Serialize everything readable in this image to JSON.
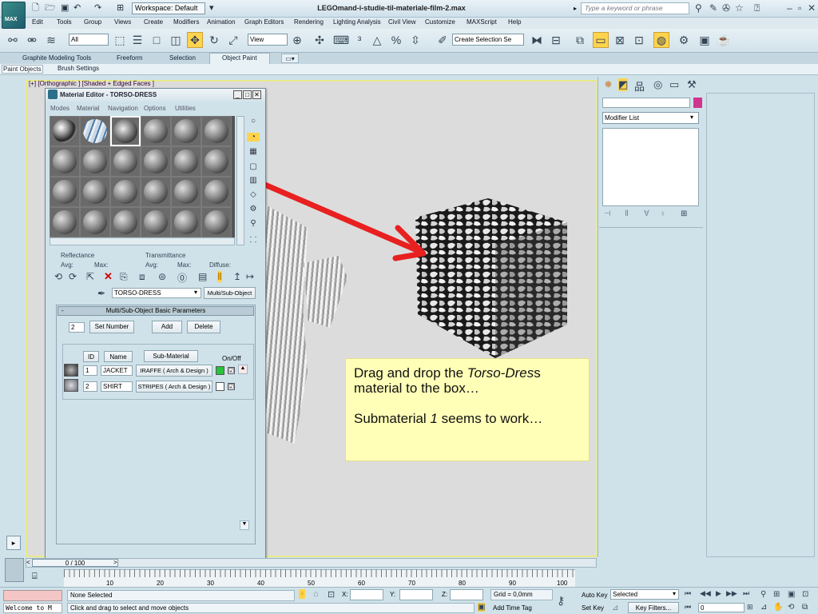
{
  "app": {
    "logo_text": "MAX",
    "workspace": "Workspace: Default",
    "window_title": "LEGOmand-i-studie-til-materiale-film-2.max",
    "search_placeholder": "Type a keyword or phrase"
  },
  "menus": [
    "Edit",
    "Tools",
    "Group",
    "Views",
    "Create",
    "Modifiers",
    "Animation",
    "Graph Editors",
    "Rendering",
    "Lighting Analysis",
    "Civil View",
    "Customize",
    "MAXScript",
    "Help"
  ],
  "toolbar": {
    "selection_filter": "All",
    "ref_coord": "View",
    "named_selection": "Create Selection Se"
  },
  "ribbon": {
    "tabs": [
      "Graphite Modeling Tools",
      "Freeform",
      "Selection",
      "Object Paint"
    ],
    "active_tab": "Object Paint",
    "subtabs": [
      "Paint Objects",
      "Brush Settings"
    ]
  },
  "viewport": {
    "label": "[+] [Orthographic ] [Shaded + Edged Faces ]"
  },
  "material_editor": {
    "title": "Material Editor - TORSO-DRESS",
    "menus": [
      "Modes",
      "Material",
      "Navigation",
      "Options",
      "Utilities"
    ],
    "reflectance_label": "Reflectance",
    "transmittance_label": "Transmittance",
    "avg1": "Avg:",
    "max1": "Max:",
    "avg2": "Avg:",
    "max2": "Max:",
    "diffuse": "Diffuse:",
    "material_name": "TORSO-DRESS",
    "material_type": "Multi/Sub-Object",
    "rollout_title": "Multi/Sub-Object Basic Parameters",
    "rollout_toggle": "-",
    "count": "2",
    "set_number": "Set Number",
    "add": "Add",
    "delete": "Delete",
    "col_id": "ID",
    "col_name": "Name",
    "col_submat": "Sub-Material",
    "col_onoff": "On/Off",
    "rows": [
      {
        "id": "1",
        "name": "JACKET",
        "submaterial": "IRAFFE  ( Arch & Design )",
        "color": "#27c33a",
        "checked": "☑"
      },
      {
        "id": "2",
        "name": "SHIRT",
        "submaterial": "STRIPES  ( Arch & Design )",
        "color": "#ffffff",
        "checked": "☑"
      }
    ]
  },
  "note": {
    "line1_a": "Drag and drop the ",
    "line1_b": "Torso-Dres",
    "line1_c": "s",
    "line2": "material to the box…",
    "line3_a": "Submaterial ",
    "line3_b": "1",
    "line3_c": " seems to work…"
  },
  "command_panel": {
    "modifier_list": "Modifier List"
  },
  "timeline": {
    "slider": "0 / 100",
    "ticks": [
      "10",
      "20",
      "30",
      "40",
      "50",
      "60",
      "70",
      "80",
      "90",
      "100"
    ]
  },
  "status": {
    "maxscript": "Welcome to M",
    "selection": "None Selected",
    "prompt": "Click and drag to select and move objects",
    "x_label": "X:",
    "y_label": "Y:",
    "z_label": "Z:",
    "grid": "Grid = 0,0mm",
    "add_time_tag": "Add Time Tag",
    "auto_key": "Auto Key",
    "set_key": "Set Key",
    "selected": "Selected",
    "key_filters": "Key Filters...",
    "frame": "0"
  }
}
